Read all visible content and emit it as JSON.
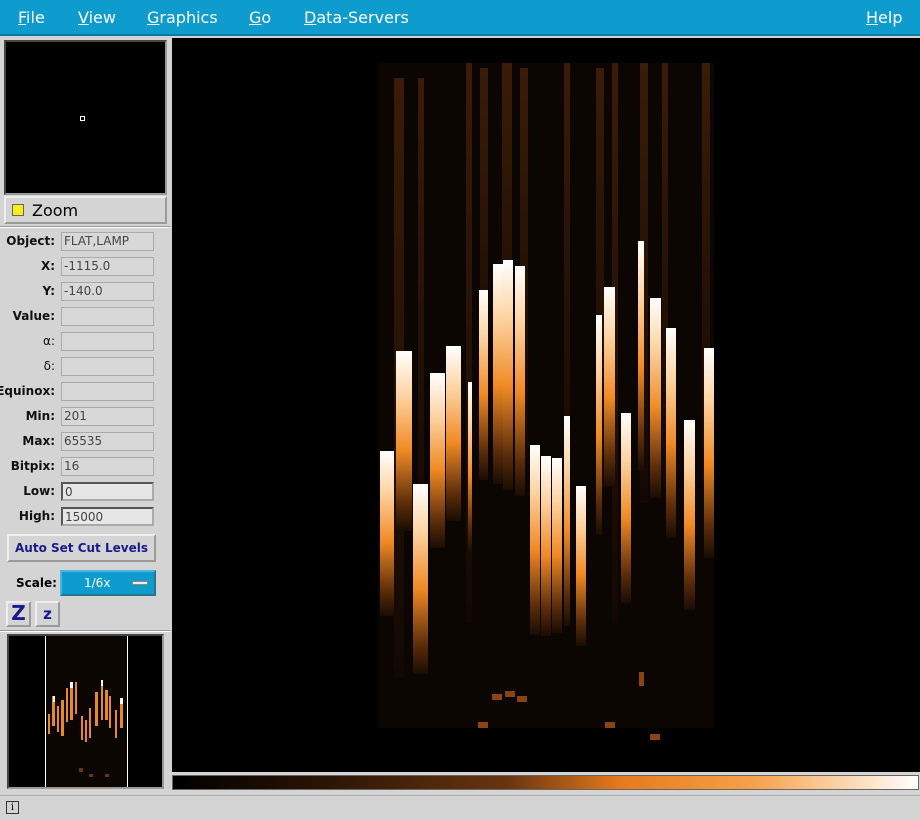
{
  "menu": {
    "file": "File",
    "file_hot": "F",
    "file_rest": "ile",
    "view": "View",
    "view_hot": "V",
    "view_rest": "iew",
    "graphics": "Graphics",
    "graphics_hot": "G",
    "graphics_rest": "raphics",
    "go": "Go",
    "go_hot": "G",
    "go_rest": "o",
    "data_servers": "Data-Servers",
    "data_servers_hot": "D",
    "data_servers_rest": "ata-Servers",
    "help": "Help",
    "help_hot": "H",
    "help_rest": "elp"
  },
  "zoom": {
    "label": "Zoom",
    "indicator_color": "#f5ee1a"
  },
  "info": {
    "object": {
      "label": "Object:",
      "value": "FLAT,LAMP"
    },
    "x": {
      "label": "X:",
      "value": "-1115.0"
    },
    "y": {
      "label": "Y:",
      "value": "-140.0"
    },
    "value": {
      "label": "Value:",
      "value": ""
    },
    "alpha": {
      "label": "α:",
      "value": ""
    },
    "delta": {
      "label": "δ:",
      "value": ""
    },
    "equinox": {
      "label": "Equinox:",
      "value": ""
    },
    "min": {
      "label": "Min:",
      "value": "201"
    },
    "max": {
      "label": "Max:",
      "value": "65535"
    },
    "bitpix": {
      "label": "Bitpix:",
      "value": "16"
    },
    "low": {
      "label": "Low:",
      "value": "0"
    },
    "high": {
      "label": "High:",
      "value": "15000"
    }
  },
  "cuts": {
    "auto_label": "Auto Set Cut Levels"
  },
  "scale": {
    "label": "Scale:",
    "value": "1/6x"
  },
  "zoom_buttons": {
    "zoom_in": "Z",
    "zoom_out": "z"
  },
  "colors": {
    "accent": "#0e9ccf",
    "panel": "#d4d4d4",
    "image_bg": "#000000"
  },
  "status": {
    "icon": "info-icon",
    "text": ""
  }
}
